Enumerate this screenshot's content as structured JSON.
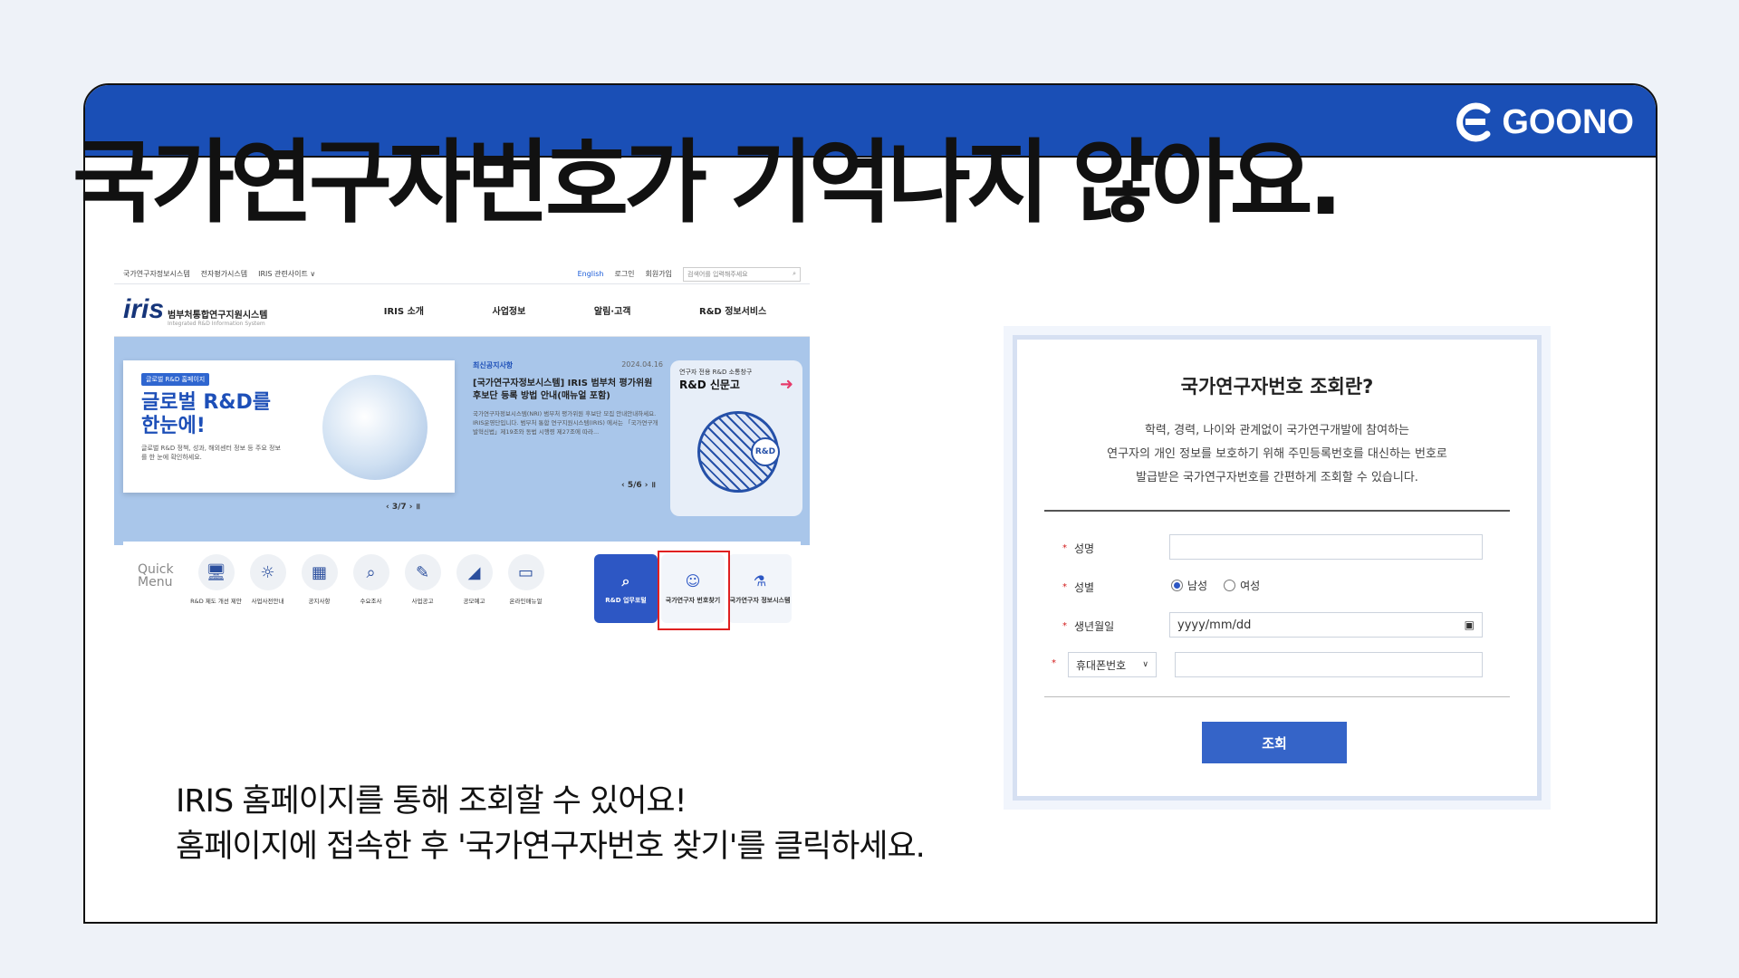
{
  "brand": {
    "logo_text": "GOONO",
    "accent": "#1a4fb6"
  },
  "headline": "국가연구자번호가 기억나지 않아요.",
  "caption": {
    "line1": "IRIS 홈페이지를 통해 조회할 수 있어요!",
    "line2": "홈페이지에 접속한 후 '국가연구자번호 찾기'를 클릭하세요."
  },
  "iris": {
    "topbar": {
      "links": [
        "국가연구자정보시스템",
        "전자평가시스템",
        "IRIS 관련사이트 ∨"
      ],
      "lang": "English",
      "login": "로그인",
      "signup": "회원가입",
      "search_placeholder": "검색어를 입력해주세요"
    },
    "logo": {
      "word": "iris",
      "name": "범부처통합연구지원시스템",
      "sub": "Integrated R&D Information System"
    },
    "menu": [
      "IRIS 소개",
      "사업정보",
      "알림·고객",
      "R&D 정보서비스"
    ],
    "banner": {
      "tag": "글로벌 R&D 홈페이지",
      "big1": "글로벌 R&D를",
      "big2": "한눈에!",
      "small": "글로벌 R&D 정책, 성과, 해외센터 정보 등 주요 정보를 한 눈에 확인하세요.",
      "pager": "‹ 3/7 ›  ॥"
    },
    "notice": {
      "label": "최신공지사항",
      "date": "2024.04.16",
      "title": "[국가연구자정보시스템] IRIS 범부처 평가위원 후보단 등록 방법 안내(매뉴얼 포함)",
      "body": "국가연구자정보시스템(NRI) 범부처 평가위원 후보단 모집 안내안내하세요. IRIS운영단입니다. 범부처 통합 연구지원시스템(IRIS) 에서는 「국가연구개발혁신법」제19조와 동법 시행령 제27조에 따라...",
      "pager": "‹ 5/6 ›  ॥"
    },
    "rnd_card": {
      "small": "연구자 전용 R&D 소통창구",
      "big": "R&D 신문고",
      "badge": "R&D"
    },
    "quick": {
      "label1": "Quick",
      "label2": "Menu",
      "items": [
        {
          "label": "R&D 제도 개선 제안",
          "icon": "monitor-gear-icon"
        },
        {
          "label": "사업사전안내",
          "icon": "lightbulb-icon"
        },
        {
          "label": "공지사항",
          "icon": "building-icon"
        },
        {
          "label": "수요조사",
          "icon": "magnifier-icon"
        },
        {
          "label": "사업공고",
          "icon": "document-pen-icon"
        },
        {
          "label": "공모예고",
          "icon": "megaphone-icon"
        },
        {
          "label": "온라인매뉴얼",
          "icon": "laptop-icon"
        }
      ],
      "box_portal": "R&D 업무포털",
      "box_find": "국가연구자 번호찾기",
      "box_info": "국가연구자 정보시스템"
    }
  },
  "form": {
    "title": "국가연구자번호 조회란?",
    "desc1": "학력, 경력, 나이와 관계없이 국가연구개발에 참여하는",
    "desc2": "연구자의 개인 정보를 보호하기 위해 주민등록번호를 대신하는 번호로",
    "desc3": "발급받은 국가연구자번호를 간편하게 조회할 수 있습니다.",
    "name_label": "성명",
    "gender_label": "성별",
    "gender_male": "남성",
    "gender_female": "여성",
    "gender_selected": "남성",
    "birth_label": "생년월일",
    "birth_placeholder": "yyyy/mm/dd",
    "phone_select": "휴대폰번호",
    "submit": "조회"
  }
}
